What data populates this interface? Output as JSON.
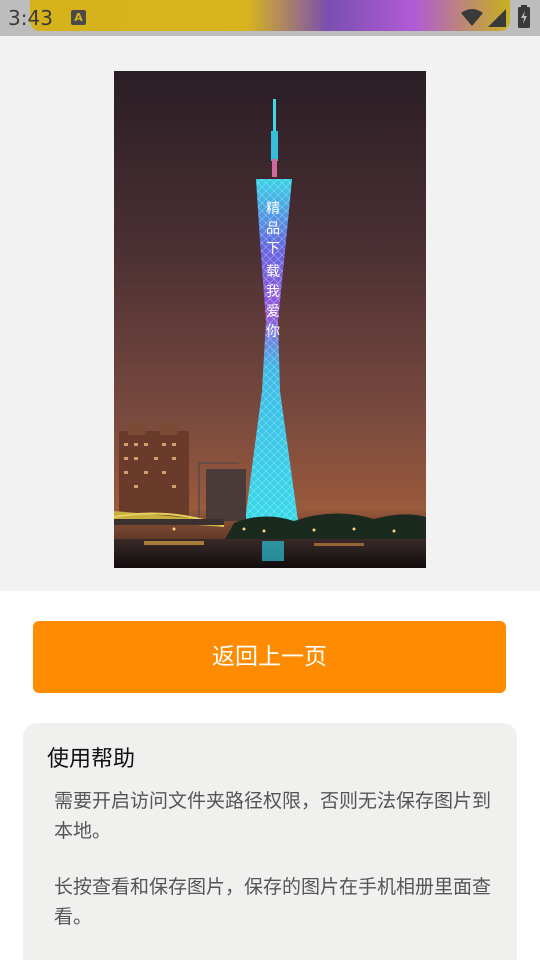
{
  "status_bar": {
    "time": "3:43",
    "notification_icon_letter": "A",
    "icons": [
      "wifi-icon",
      "signal-icon",
      "battery-icon"
    ]
  },
  "image": {
    "description_text": "精品下载我爱你"
  },
  "back_button": {
    "label": "返回上一页",
    "color": "#ff8c00"
  },
  "help": {
    "title": "使用帮助",
    "paragraphs": [
      "需要开启访问文件夹路径权限，否则无法保存图片到本地。",
      "长按查看和保存图片，保存的图片在手机相册里面查看。"
    ]
  }
}
